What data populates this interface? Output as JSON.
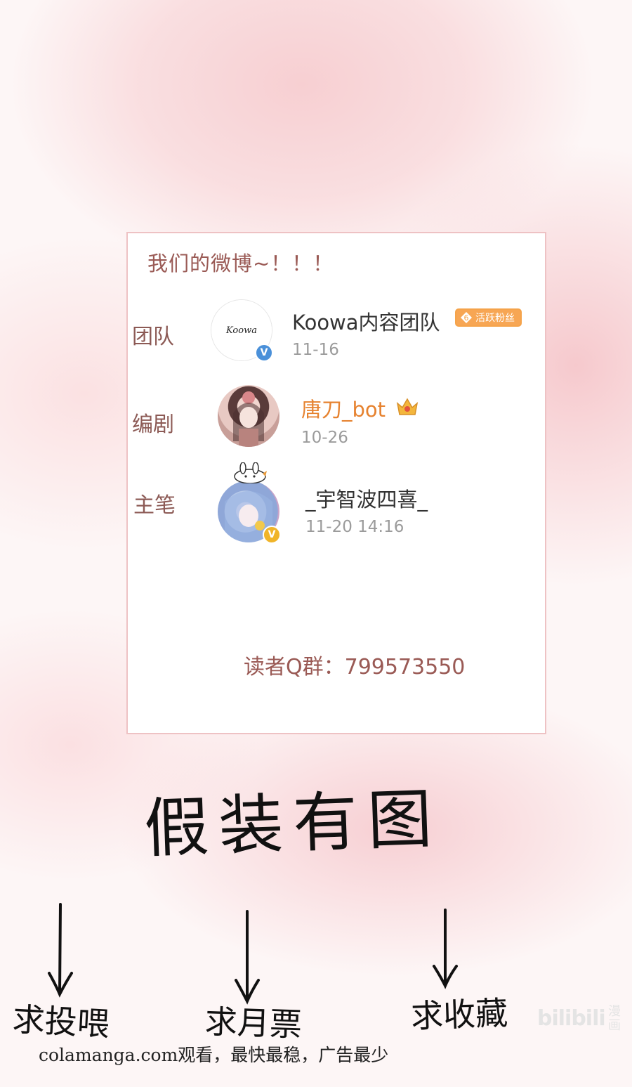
{
  "card": {
    "title": "我们的微博~！！！",
    "entries": [
      {
        "role": "团队",
        "name": "Koowa内容团队",
        "date": "11-16",
        "logo_text": "Koowa",
        "badge_level": "6",
        "badge_text": "活跃粉丝",
        "verified": "V"
      },
      {
        "role": "编剧",
        "name": "唐刀_bot",
        "date": "10-26"
      },
      {
        "role": "主笔",
        "name": "_宇智波四喜_",
        "date": "11-20 14:16",
        "verified": "V"
      }
    ],
    "qq_group": "读者Q群：799573550"
  },
  "handwriting": {
    "headline": "假装有图",
    "asks": [
      "求投喂",
      "求月票",
      "求收藏"
    ]
  },
  "watermark": "colamanga.com观看，最快最稳，广告最少",
  "bilibili": {
    "logo": "bilibili",
    "sub": "漫画"
  },
  "colors": {
    "accent_text": "#9a5a55",
    "name_orange": "#e6822f",
    "verify_blue": "#4a90d9",
    "verify_gold": "#f0b429",
    "border_pink": "#eec2c4"
  }
}
